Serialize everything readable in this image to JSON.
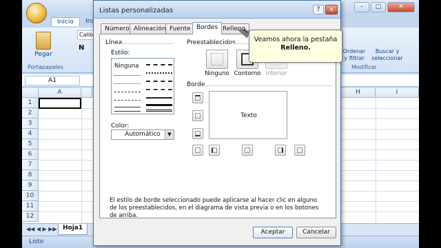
{
  "excel": {
    "ribbon_tabs": [
      "Inicio",
      "Ins"
    ],
    "font_name": "Calib",
    "bold_label": "N",
    "paste_label": "Pegar",
    "clipboard_group": "Portapapeles",
    "sort_label_1": "Ordenar",
    "sort_label_2": "y filtrar",
    "find_label_1": "Buscar y",
    "find_label_2": "seleccionar",
    "modify_group": "Modificar",
    "name_box": "A1",
    "column_headers_left": [
      "A"
    ],
    "column_headers_right": [
      "H",
      "I"
    ],
    "row_numbers": [
      "1",
      "2",
      "3",
      "4",
      "5",
      "6",
      "7",
      "8",
      "9",
      "10",
      "11",
      "12"
    ],
    "sheet_tab": "Hoja1",
    "status": "Listo"
  },
  "dialog": {
    "title": "Listas personalizadas",
    "help_label": "?",
    "close_label": "x",
    "tabs": [
      "Número",
      "Alineación",
      "Fuente",
      "Bordes",
      "Relleno"
    ],
    "active_tab": "Bordes",
    "line_group": "Línea",
    "style_label": "Estilo:",
    "style_none": "Ninguna",
    "color_label": "Color:",
    "color_value": "Automático",
    "presets_group": "Preestablecidos",
    "presets": [
      "Ninguno",
      "Contorno",
      "Interior"
    ],
    "border_group": "Borde",
    "preview_text": "Texto",
    "description": "El estilo de borde seleccionado puede aplicarse al hacer clic en alguno de los preestablecidos, en el diagrama de vista previa o en los botones de arriba.",
    "ok_label": "Aceptar",
    "cancel_label": "Cancelar"
  },
  "tooltip": {
    "line1": "Veamos ahora la pestaña",
    "line2": "Relleno."
  },
  "colors": {
    "tooltip_bg": "#ffffe1",
    "ribbon_text": "#15428b"
  }
}
